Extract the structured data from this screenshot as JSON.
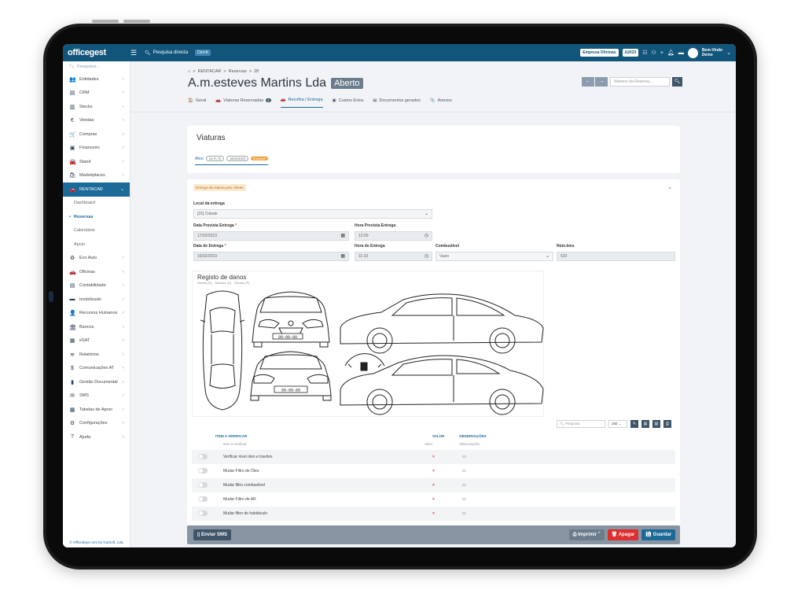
{
  "app": {
    "logo": "officegest"
  },
  "topbar": {
    "quick_search": "Pesquisa directa",
    "shortcut": "Ctrl+K",
    "company": "Empresa Oficinas",
    "year": "A2023",
    "user_line1": "Bem-Vindo",
    "user_line2": "Demo"
  },
  "sidebar": {
    "search_placeholder": "Pesquisar...",
    "items": [
      {
        "label": "Entidades",
        "icon": "👥"
      },
      {
        "label": "CRM",
        "icon": "▤"
      },
      {
        "label": "Stocks",
        "icon": "▥"
      },
      {
        "label": "Vendas",
        "icon": "€"
      },
      {
        "label": "Compras",
        "icon": "🛒"
      },
      {
        "label": "Financeiro",
        "icon": "▣"
      },
      {
        "label": "Stand",
        "icon": "🚘"
      },
      {
        "label": "Marketplaces",
        "icon": "🛍"
      },
      {
        "label": "RENTACAR",
        "icon": "🚗"
      }
    ],
    "subitems": [
      "Dashboard",
      "Reservas",
      "Calendário",
      "Apoio"
    ],
    "items2": [
      {
        "label": "Eco Auto",
        "icon": "♻"
      },
      {
        "label": "Oficinas",
        "icon": "🚗"
      },
      {
        "label": "Contabilidade",
        "icon": "▤"
      },
      {
        "label": "Imobilizado",
        "icon": "▬"
      },
      {
        "label": "Recursos Humanos",
        "icon": "👤"
      },
      {
        "label": "Bancos",
        "icon": "🏛"
      },
      {
        "label": "eSAT",
        "icon": "▦"
      },
      {
        "label": "Relatórios",
        "icon": "≋"
      },
      {
        "label": "Comunicações AT",
        "icon": "$"
      },
      {
        "label": "Gestão Documental",
        "icon": "▮"
      },
      {
        "label": "SMS",
        "icon": "✉"
      },
      {
        "label": "Tabelas de Apoio",
        "icon": "▦"
      },
      {
        "label": "Configurações",
        "icon": "⚙"
      },
      {
        "label": "Ajuda",
        "icon": "?"
      }
    ],
    "footer": "© Officedays.com by GuiSoft, Lda."
  },
  "page": {
    "breadcrumb": [
      "RENTACAR",
      "Reservas",
      "28"
    ],
    "title": "A.m.esteves Martins Lda",
    "status": "Aberto",
    "reserve_placeholder": "Número da Reserva..."
  },
  "tabs": [
    {
      "label": "Geral",
      "icon": "🏠"
    },
    {
      "label": "Viaturas Reservadas",
      "icon": "🚗",
      "count": "1"
    },
    {
      "label": "Recolha / Entrega",
      "icon": "🚗",
      "active": true
    },
    {
      "label": "Custos Extra",
      "icon": "▣"
    },
    {
      "label": "Documentos gerados",
      "icon": "▤"
    },
    {
      "label": "Anexos",
      "icon": "📎"
    }
  ],
  "viaturas": {
    "title": "Viaturas",
    "car_tab": "Alice",
    "plate": "24-FI-75",
    "date": "16/02/2023",
    "state": "Entregue"
  },
  "entrega": {
    "tag": "Entrega da viatura pelo cliente",
    "local_label": "Local da entrega",
    "local_value": "[15] Cidade",
    "data_prev_label": "Data Prevista Entrega",
    "data_prev_value": "17/02/2023",
    "hora_prev_label": "Hora Prevista Entrega",
    "hora_prev_value": "12:00",
    "data_label": "Data de Entrega",
    "data_value": "16/02/2023",
    "hora_label": "Hora de Entrega",
    "hora_value": "11:10",
    "comb_label": "Combustível",
    "comb_value": "Vazio",
    "kms_label": "Núm.kms",
    "kms_value": "520"
  },
  "danos": {
    "title": "Registo de danos",
    "legend": [
      "Riscos (R)",
      "Mossas (O)",
      "Partido (P)"
    ],
    "plate_front": "00-00-00",
    "plate_rear": "00-00-00"
  },
  "table": {
    "search_placeholder": "Pesquisa",
    "page_size": "250",
    "headers": [
      "ITEM A VERIFICAR",
      "VALOR",
      "OBSERVAÇÕES"
    ],
    "filters": [
      "Item a verificar",
      "Valor",
      "Observações"
    ],
    "rows": [
      {
        "item": "Verificar nivel oleo e travões",
        "value": "×"
      },
      {
        "item": "Mudar Filtro de Óleo",
        "value": "×"
      },
      {
        "item": "Mudar filtro combustível",
        "value": "×"
      },
      {
        "item": "Mudar Filtro de AR",
        "value": "×"
      },
      {
        "item": "Mudar filtro de habitáculo",
        "value": "×"
      }
    ]
  },
  "footer": {
    "sms": "Enviar SMS",
    "print": "Imprimir",
    "delete": "Apagar",
    "save": "Guardar"
  }
}
